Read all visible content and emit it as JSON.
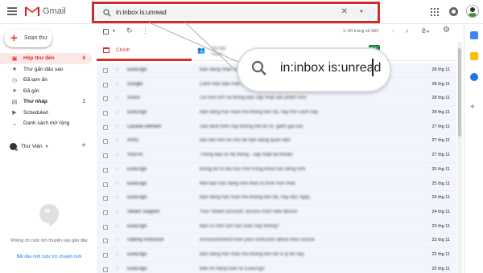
{
  "app": {
    "brand": "Gmail"
  },
  "search": {
    "query": "in:inbox is:unread"
  },
  "compose": {
    "label": "Soạn thư"
  },
  "sidebar": {
    "items": [
      {
        "label": "Hộp thư đến",
        "count": "8",
        "icon": "inbox-icon"
      },
      {
        "label": "Thư gắn dấu sao",
        "count": "",
        "icon": "star-icon"
      },
      {
        "label": "Đã tạm ẩn",
        "count": "",
        "icon": "clock-icon"
      },
      {
        "label": "Đã gửi",
        "count": "",
        "icon": "send-icon"
      },
      {
        "label": "Thư nháp",
        "count": "2",
        "icon": "draft-icon"
      },
      {
        "label": "Scheduled",
        "count": "",
        "icon": "label-icon"
      },
      {
        "label": "Danh sách mở rộng",
        "count": "",
        "icon": "chevron-down-icon"
      }
    ],
    "hangouts_user": "Thư Viện",
    "empty_hangouts": "Không có cuộc trò chuyện nào gần đây",
    "start_chat": "Bắt đầu một cuộc trò chuyện mới"
  },
  "toolbar": {
    "pagination": "1–50 trong số 965",
    "lang_icon": "ê"
  },
  "tabs": {
    "primary": "Chính",
    "social_blurred": "Xã hội",
    "new_badge": "mới"
  },
  "emails": [
    {
      "sender": "EasEngo",
      "snippet": "Bạn đang nhận được thư này vì đã đăng ký nhận bản tin",
      "date": "28 thg 11"
    },
    {
      "sender": "Google",
      "snippet": "Cảnh báo bảo mật cho tài khoản được liên kết",
      "date": "28 thg 11"
    },
    {
      "sender": "Scoro",
      "snippet": "Lời mời API và thông báo cập nhật sản phẩm mới",
      "date": "28 thg 11"
    },
    {
      "sender": "EasEngo",
      "snippet": "Bạn đang học hoài mà không tiến bộ, hãy thử cách này",
      "date": "28 thg 11"
    },
    {
      "sender": "Lazada vietnam",
      "snippet": "Săn deal hôm nay không thể bỏ lỡ, giảm giá sốc",
      "date": "27 thg 11"
    },
    {
      "sender": "AHIS",
      "snippet": "Bài viết mới về chủ đề bạn đang quan tâm",
      "date": "27 thg 11"
    },
    {
      "sender": "VIGFAI",
      "snippet": "Thông báo từ hệ thống - cập nhật tài khoản",
      "date": "27 thg 11"
    },
    {
      "sender": "EasEngo",
      "snippet": "Đừng bỏ lỡ bài học mới trong khóa học tiếng Anh",
      "date": "26 thg 11"
    },
    {
      "sender": "EasEngo",
      "snippet": "Mời bạn học tiếng Anh theo lộ trình mới nhất",
      "date": "25 thg 11"
    },
    {
      "sender": "EasEngo",
      "snippet": "Bạn đang học hoài mà không tiến bộ, hãy đọc ngay",
      "date": "24 thg 11"
    },
    {
      "sender": "Steam Support",
      "snippet": "Your Steam account: access from new device",
      "date": "24 thg 11"
    },
    {
      "sender": "EasEngo",
      "snippet": "Bạn có nhớ lịch học tuần này không?",
      "date": "23 thg 11"
    },
    {
      "sender": "Udemy Instructor",
      "snippet": "Announcement from your instructor about new course",
      "date": "23 thg 11"
    },
    {
      "sender": "EasEngo",
      "snippet": "Bạn đang học hoài mà không tiến bộ vì lý do này",
      "date": "22 thg 11"
    },
    {
      "sender": "EasEngo",
      "snippet": "Bản tin hàng tuần từ EasEngo",
      "date": "22 thg 11"
    }
  ],
  "colors": {
    "callout_border": "#d32a2a",
    "active_red": "#d93025",
    "row_bg": "#f2f6fc"
  }
}
